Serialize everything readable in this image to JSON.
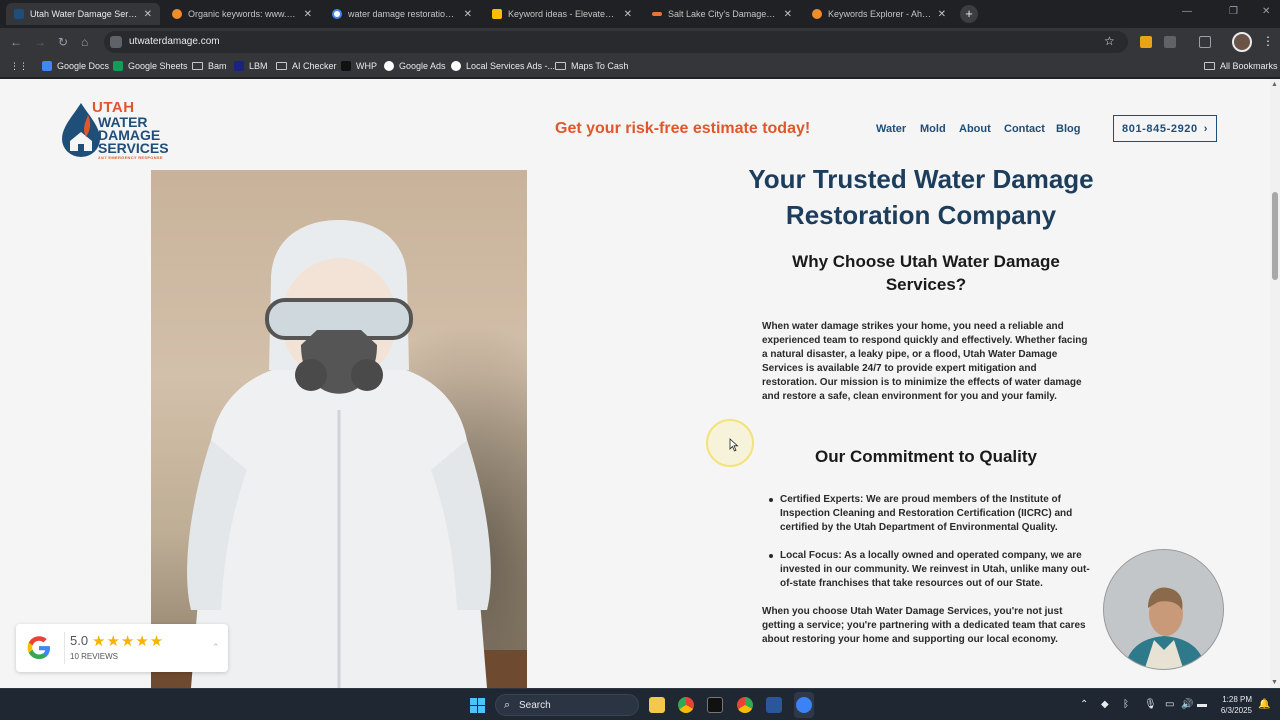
{
  "browser": {
    "tabs": [
      {
        "title": "Utah Water Damage Services | ...",
        "active": true
      },
      {
        "title": "Organic keywords: www.utwate...",
        "active": false
      },
      {
        "title": "water damage restoration salt l...",
        "active": false
      },
      {
        "title": "Keyword ideas - Elevated Auto...",
        "active": false
      },
      {
        "title": "Salt Lake City's Damage Restor...",
        "active": false
      },
      {
        "title": "Keywords Explorer - Ahrefs",
        "active": false
      }
    ],
    "new_tab_label": "+",
    "url": "utwaterdamage.com",
    "bookmarks": [
      "Google Docs",
      "Google Sheets",
      "Bam",
      "LBM",
      "AI Checker",
      "WHP",
      "Google Ads",
      "Local Services Ads -...",
      "Maps To Cash"
    ],
    "all_bookmarks": "All Bookmarks"
  },
  "site": {
    "logo": {
      "line1": "UTAH",
      "line2": "WATER",
      "line3": "DAMAGE",
      "line4": "SERVICES",
      "tagline": "24/7 EMERGENCY RESPONSE"
    },
    "promo": "Get your risk-free estimate today!",
    "nav": [
      "Water",
      "Mold",
      "About",
      "Contact",
      "Blog"
    ],
    "phone": "801-845-2920",
    "heading": "Your Trusted Water Damage Restoration Company",
    "why_heading": "Why Choose Utah Water Damage Services?",
    "why_text": "When water damage strikes your home, you need a reliable and experienced team to respond quickly and effectively. Whether facing a natural disaster, a leaky pipe, or a flood, Utah Water Damage Services is available 24/7 to provide expert mitigation and restoration. Our mission is to minimize the effects of water damage and restore a safe, clean environment for you and your family.",
    "commitment_heading": "Our Commitment to Quality",
    "bullets": [
      "Certified Experts: We are proud members of the Institute of Inspection Cleaning and Restoration Certification (IICRC) and certified by the Utah Department of Environmental Quality.",
      "Local Focus: As a locally owned and operated company, we are invested in our community. We reinvest in Utah, unlike many out-of-state franchises that take resources out of our State."
    ],
    "closing_text": "When you choose Utah Water Damage Services, you're not just getting a service; you're partnering with a dedicated team that cares about restoring your home and supporting our local economy.",
    "review": {
      "score": "5.0",
      "stars": "★★★★★",
      "rating": 5,
      "count_label": "10 REVIEWS"
    }
  },
  "taskbar": {
    "search_label": "Search",
    "time": "1:28 PM",
    "date": "6/3/2025"
  }
}
